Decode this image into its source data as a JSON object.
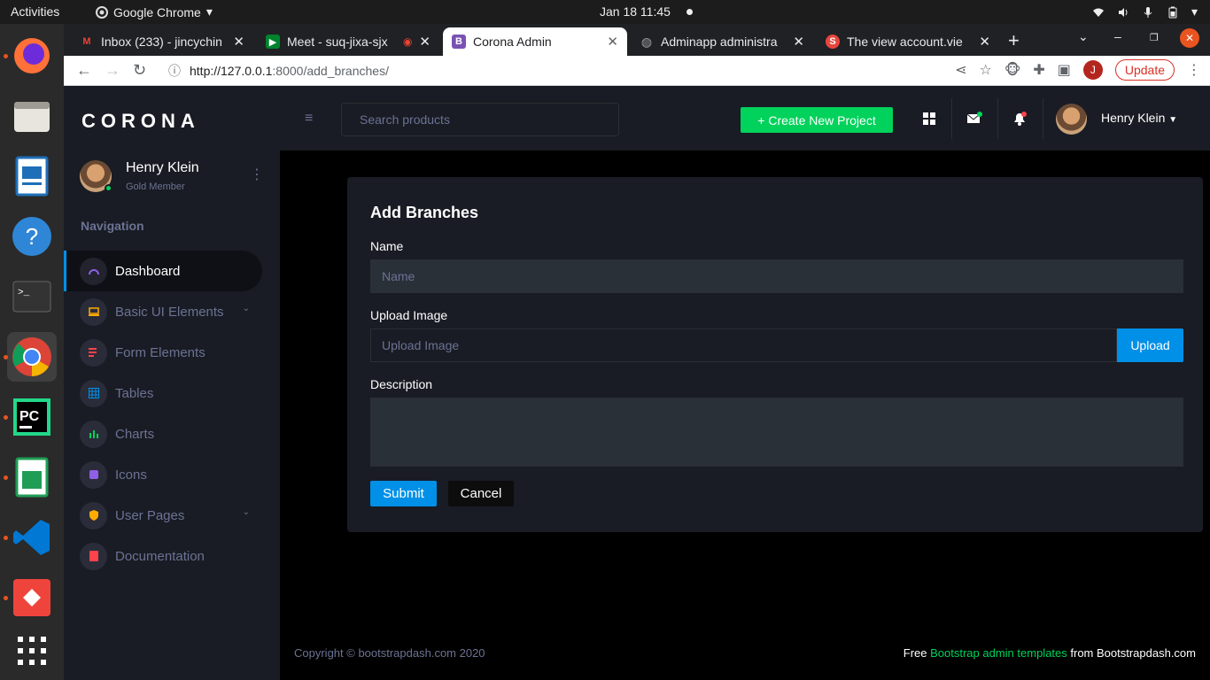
{
  "system": {
    "activities": "Activities",
    "app_name": "Google Chrome",
    "clock": "Jan 18  11:45"
  },
  "browser": {
    "tabs": [
      {
        "title": "Inbox (233) - jincychin",
        "icon": "gmail-icon"
      },
      {
        "title": "Meet - suq-jixa-sjx",
        "icon": "meet-icon"
      },
      {
        "title": "Corona Admin",
        "icon": "bootstrap-icon"
      },
      {
        "title": "Adminapp administra",
        "icon": "globe-icon"
      },
      {
        "title": "The view account.vie",
        "icon": "s-icon"
      }
    ],
    "url_host": "http://127.0.0.1",
    "url_path": ":8000/add_branches/",
    "profile_initial": "J",
    "update_label": "Update"
  },
  "app": {
    "brand": "CORONA",
    "user": {
      "name": "Henry Klein",
      "role": "Gold Member"
    },
    "nav_category": "Navigation",
    "nav": [
      {
        "label": "Dashboard",
        "color": "#8f5fe8"
      },
      {
        "label": "Basic UI Elements",
        "color": "#ffab00",
        "has_chevron": true
      },
      {
        "label": "Form Elements",
        "color": "#fc424a"
      },
      {
        "label": "Tables",
        "color": "#0090e7"
      },
      {
        "label": "Charts",
        "color": "#00d25b"
      },
      {
        "label": "Icons",
        "color": "#8f5fe8"
      },
      {
        "label": "User Pages",
        "color": "#ffab00",
        "has_chevron": true
      },
      {
        "label": "Documentation",
        "color": "#fc424a"
      }
    ],
    "topnav": {
      "search_placeholder": "Search products",
      "create_label": "+ Create New Project",
      "user_name": "Henry Klein"
    },
    "form": {
      "title": "Add Branches",
      "name_label": "Name",
      "name_placeholder": "Name",
      "image_label": "Upload Image",
      "image_placeholder": "Upload Image",
      "upload_label": "Upload",
      "description_label": "Description",
      "submit_label": "Submit",
      "cancel_label": "Cancel"
    },
    "footer": {
      "copyright": "Copyright © bootstrapdash.com 2020",
      "free": "Free ",
      "link": "Bootstrap admin templates",
      "from": " from Bootstrapdash.com"
    }
  }
}
